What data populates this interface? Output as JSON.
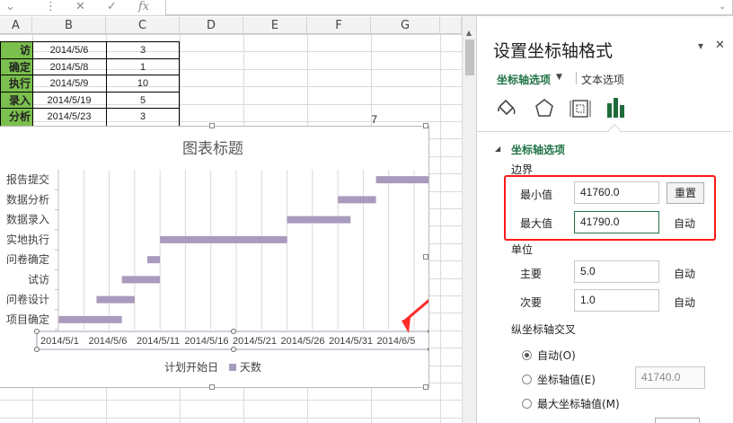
{
  "formula_bar": {
    "cancel_icon": "✕",
    "enter_icon": "✓",
    "fx_icon": "fx",
    "expand_icon": "⌄",
    "dots_icon": "⋮",
    "content": ""
  },
  "sheet": {
    "columns": [
      "A",
      "B",
      "C",
      "D",
      "E",
      "F",
      "G"
    ],
    "rows": [
      {
        "a": "访",
        "b": "2014/5/6",
        "c": "3"
      },
      {
        "a": "确定",
        "b": "2014/5/8",
        "c": "1"
      },
      {
        "a": "执行",
        "b": "2014/5/9",
        "c": "10"
      },
      {
        "a": "录入",
        "b": "2014/5/19",
        "c": "5"
      },
      {
        "a": "分析",
        "b": "2014/5/23",
        "c": "3"
      }
    ],
    "stray_value": "7"
  },
  "chart": {
    "title": "图表标题",
    "legend": {
      "x_label": "计划开始日",
      "series": "天数"
    },
    "colors": {
      "bar": "#a99bbd",
      "grid": "#d9d9d9",
      "arrow": "#ff2a2a"
    },
    "chart_data": {
      "type": "bar",
      "orientation": "horizontal",
      "categories": [
        "报告提交",
        "数据分析",
        "数据录入",
        "实地执行",
        "问卷确定",
        "试访",
        "问卷设计",
        "项目确定"
      ],
      "start": [
        "2014/5/26",
        "2014/5/23",
        "2014/5/19",
        "2014/5/9",
        "2014/5/8",
        "2014/5/6",
        "2014/5/4",
        "2014/5/1"
      ],
      "duration_days": [
        5,
        3,
        5,
        10,
        1,
        3,
        3,
        5
      ],
      "xlim": [
        "2014/5/1",
        "2014/5/29"
      ],
      "x_ticks": [
        "2014/5/1",
        "2014/5/6",
        "2014/5/11",
        "2014/5/16",
        "2014/5/21",
        "2014/5/26",
        "2014/5/31",
        "2014/6/5"
      ],
      "series": [
        {
          "name": "天数"
        }
      ],
      "legend_position": "bottom",
      "grid": true
    }
  },
  "pane": {
    "title": "设置坐标轴格式",
    "tabs": [
      {
        "label": "坐标轴选项",
        "active": true
      },
      {
        "label": "文本选项",
        "active": false
      }
    ],
    "dropdown_icon": "▼",
    "pin_icon": "▾",
    "close_icon": "✕",
    "section_arrow": "◢",
    "section_title": "坐标轴选项",
    "bounds": {
      "title": "边界",
      "min_label": "最小值",
      "min_value": "41760.0",
      "min_button": "重置",
      "max_label": "最大值",
      "max_value": "41790.0",
      "max_state": "自动"
    },
    "units": {
      "title": "单位",
      "major_label": "主要",
      "major_value": "5.0",
      "major_state": "自动",
      "minor_label": "次要",
      "minor_value": "1.0",
      "minor_state": "自动"
    },
    "cross": {
      "title": "纵坐标轴交叉",
      "auto_label": "自动(O)",
      "value_label": "坐标轴值(E)",
      "value_field": "41740.0",
      "max_label": "最大坐标轴值(M)"
    },
    "colors": {
      "accent_green": "#217346",
      "highlight_red": "#ff1a1a"
    }
  }
}
